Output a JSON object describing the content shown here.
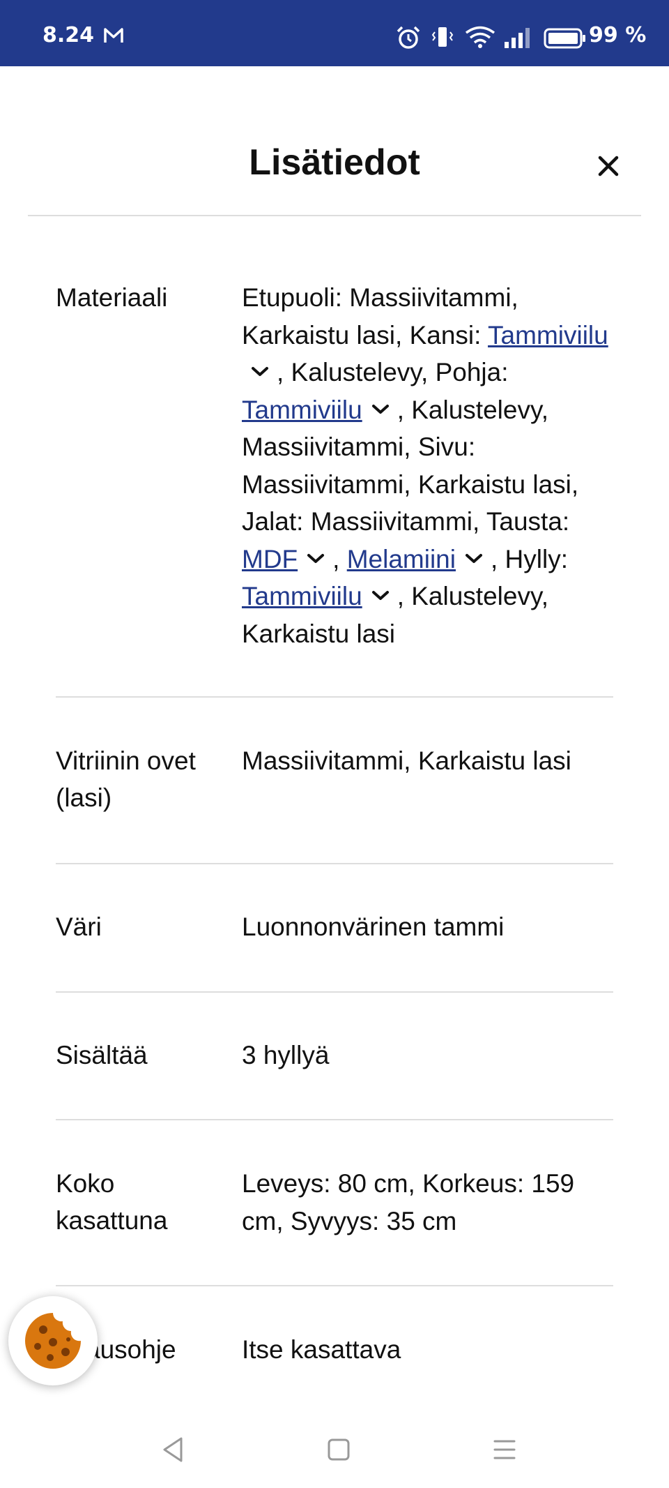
{
  "status_bar": {
    "time": "8.24",
    "battery": "99 %"
  },
  "header": {
    "title": "Lisätiedot"
  },
  "rows": [
    {
      "label": "Materiaali",
      "value_parts": {
        "p1": "Etupuoli: Massiivitammi, Karkaistu lasi, Kansi: ",
        "link1": "Tammiviilu",
        "p2": ", Kalustelevy, Pohja: ",
        "link2": "Tammiviilu",
        "p3": ", Kalustelevy, Massiivitammi, Sivu: Massiivitammi, Karkaistu lasi, Jalat: Massiivitammi, Tausta: ",
        "link3": "MDF",
        "p4": ", ",
        "link4": "Melamiini",
        "p5": ", Hylly: ",
        "link5": "Tammiviilu",
        "p6": ", Kalustelevy, Karkaistu lasi"
      }
    },
    {
      "label": "Vitriinin ovet (lasi)",
      "value": "Massiivitammi, Karkaistu lasi"
    },
    {
      "label": "Väri",
      "value": "Luonnonvärinen tammi"
    },
    {
      "label": "Sisältää",
      "value": "3 hyllyä"
    },
    {
      "label": "Koko kasattuna",
      "value": "Leveys: 80 cm, Korkeus: 159 cm, Syvyys: 35 cm"
    },
    {
      "label": "ausohje",
      "value": "Itse kasattava"
    }
  ],
  "colors": {
    "brand_blue": "#223a8c",
    "divider": "#dddddd",
    "cookie": "#d9770f"
  },
  "icons": {
    "close": "close-icon",
    "chevron": "chevron-down-icon",
    "cookie": "cookie-icon"
  }
}
